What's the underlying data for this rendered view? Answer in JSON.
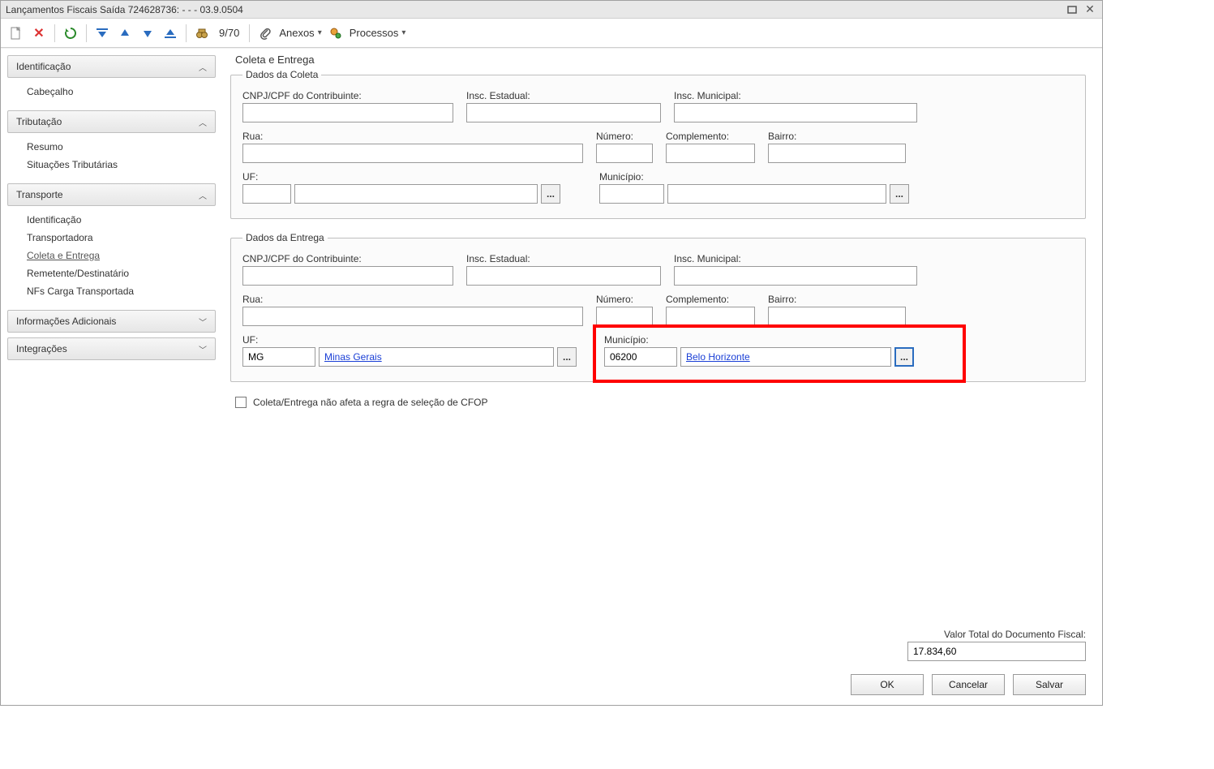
{
  "window": {
    "title": "Lançamentos Fiscais Saída 724628736:  -  -  - 03.9.0504"
  },
  "toolbar": {
    "page_indicator": "9/70",
    "anexos_label": "Anexos",
    "processos_label": "Processos"
  },
  "sidebar": {
    "groups": {
      "identificacao": {
        "header": "Identificação",
        "items": [
          "Cabeçalho"
        ]
      },
      "tributacao": {
        "header": "Tributação",
        "items": [
          "Resumo",
          "Situações Tributárias"
        ]
      },
      "transporte": {
        "header": "Transporte",
        "items": [
          "Identificação",
          "Transportadora",
          "Coleta e Entrega",
          "Remetente/Destinatário",
          "NFs Carga Transportada"
        ]
      },
      "info_adicionais": {
        "header": "Informações Adicionais"
      },
      "integracoes": {
        "header": "Integrações"
      }
    }
  },
  "main": {
    "title": "Coleta e Entrega",
    "coleta": {
      "legend": "Dados da Coleta",
      "labels": {
        "cnpj": "CNPJ/CPF do Contribuinte:",
        "insc_est": "Insc. Estadual:",
        "insc_mun": "Insc. Municipal:",
        "rua": "Rua:",
        "numero": "Número:",
        "complemento": "Complemento:",
        "bairro": "Bairro:",
        "uf": "UF:",
        "municipio": "Município:"
      },
      "values": {
        "cnpj": "",
        "insc_est": "",
        "insc_mun": "",
        "rua": "",
        "numero": "",
        "complemento": "",
        "bairro": "",
        "uf_code": "",
        "uf_name": "",
        "mun_code": "",
        "mun_name": ""
      }
    },
    "entrega": {
      "legend": "Dados da Entrega",
      "labels": {
        "cnpj": "CNPJ/CPF do Contribuinte:",
        "insc_est": "Insc. Estadual:",
        "insc_mun": "Insc. Municipal:",
        "rua": "Rua:",
        "numero": "Número:",
        "complemento": "Complemento:",
        "bairro": "Bairro:",
        "uf": "UF:",
        "municipio": "Município:"
      },
      "values": {
        "cnpj": "",
        "insc_est": "",
        "insc_mun": "",
        "rua": "",
        "numero": "",
        "complemento": "",
        "bairro": "",
        "uf_code": "MG",
        "uf_name": "Minas Gerais",
        "mun_code": "06200",
        "mun_name": "Belo Horizonte"
      }
    },
    "checkbox_label": "Coleta/Entrega não afeta a regra de seleção de CFOP",
    "total_label": "Valor Total do Documento Fiscal:",
    "total_value": "17.834,60"
  },
  "buttons": {
    "ok": "OK",
    "cancel": "Cancelar",
    "save": "Salvar"
  },
  "lookup_ellipsis": "..."
}
